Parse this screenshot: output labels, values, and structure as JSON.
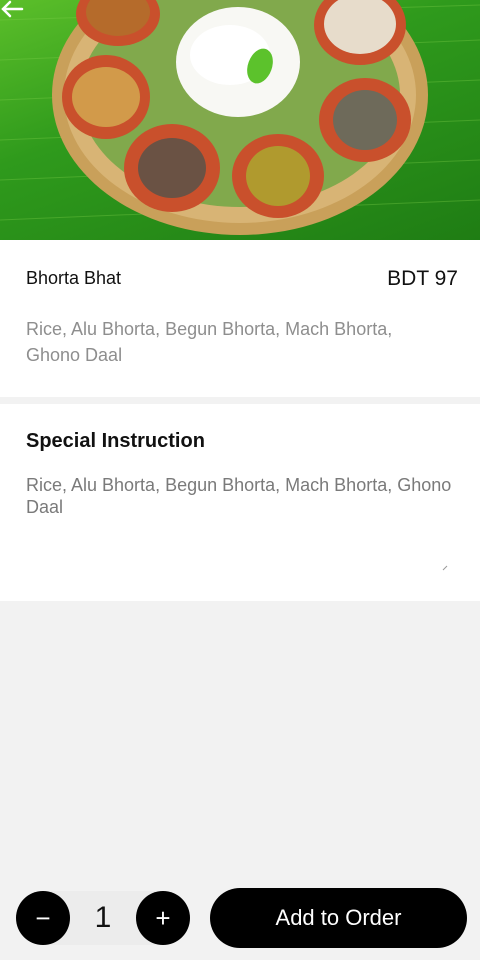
{
  "item": {
    "name": "Bhorta Bhat",
    "price": "BDT 97",
    "description": "Rice, Alu Bhorta, Begun Bhorta, Mach Bhorta, Ghono Daal"
  },
  "special_instruction": {
    "title": "Special Instruction",
    "value": "Rice, Alu Bhorta, Begun Bhorta, Mach Bhorta, Ghono Daal"
  },
  "order_bar": {
    "minus_label": "−",
    "quantity": "1",
    "plus_label": "+",
    "add_label": "Add to Order"
  },
  "icons": {
    "back": "arrow-left-icon",
    "minus": "minus-icon",
    "plus": "plus-icon"
  },
  "colors": {
    "primary_button": "#000000",
    "banana_leaf": "#2f9a1c",
    "muted_text": "#8e8e8e"
  }
}
